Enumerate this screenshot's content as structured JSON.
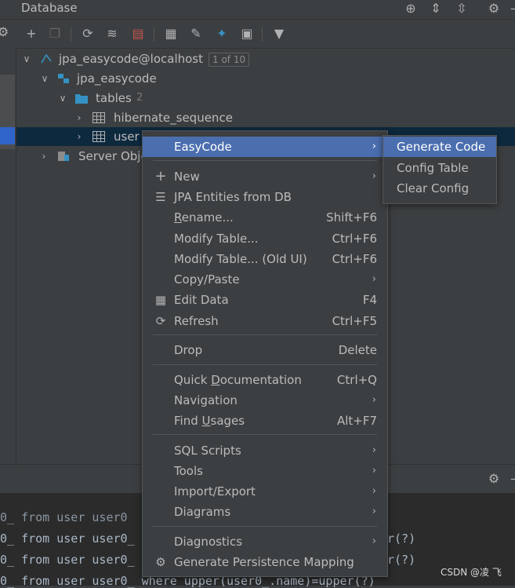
{
  "window": {
    "title": "Database"
  },
  "tree": {
    "datasource": {
      "label": "jpa_easycode@localhost",
      "badge": "1 of 10"
    },
    "schema": {
      "label": "jpa_easycode"
    },
    "tables": {
      "label": "tables",
      "count": "2"
    },
    "table1": {
      "label": "hibernate_sequence"
    },
    "table2": {
      "label": "user"
    },
    "server": {
      "label": "Server Obje"
    }
  },
  "menu": {
    "easycode": {
      "label": "EasyCode"
    },
    "new": {
      "label": "New"
    },
    "jpa": {
      "label": "JPA Entities from DB"
    },
    "rename": {
      "label_pre": "",
      "label_u": "R",
      "label_post": "ename...",
      "shortcut": "Shift+F6"
    },
    "modify": {
      "label": "Modify Table...",
      "shortcut": "Ctrl+F6"
    },
    "modify_old": {
      "label": "Modify Table... (Old UI)",
      "shortcut": "Ctrl+F6"
    },
    "copy": {
      "label": "Copy/Paste"
    },
    "edit": {
      "label": "Edit Data",
      "shortcut": "F4"
    },
    "refresh": {
      "label": "Refresh",
      "shortcut": "Ctrl+F5"
    },
    "drop": {
      "label": "Drop",
      "shortcut": "Delete"
    },
    "quickdoc": {
      "label_pre": "Quick ",
      "label_u": "D",
      "label_post": "ocumentation",
      "shortcut": "Ctrl+Q"
    },
    "navigation": {
      "label": "Navigation"
    },
    "find": {
      "label_pre": "Find ",
      "label_u": "U",
      "label_post": "sages",
      "shortcut": "Alt+F7"
    },
    "sql": {
      "label": "SQL Scripts"
    },
    "tools": {
      "label": "Tools"
    },
    "import": {
      "label": "Import/Export"
    },
    "diagrams": {
      "label": "Diagrams"
    },
    "diagnostics": {
      "label": "Diagnostics"
    },
    "persistence": {
      "label": "Generate Persistence Mapping"
    }
  },
  "submenu": {
    "generate": {
      "label": "Generate Code"
    },
    "config": {
      "label": "Config Table"
    },
    "clear": {
      "label": "Clear Config"
    }
  },
  "console": {
    "line1": "0_ from user user0",
    "line2": "0_ from user user0_",
    "line3": "0_ from user user0_",
    "line4": "0_ from user user0_ where upper(user0_.name)=upper(?)",
    "right2": "r(?)",
    "right3": "r(?)"
  },
  "watermark": "CSDN @凌 飞"
}
